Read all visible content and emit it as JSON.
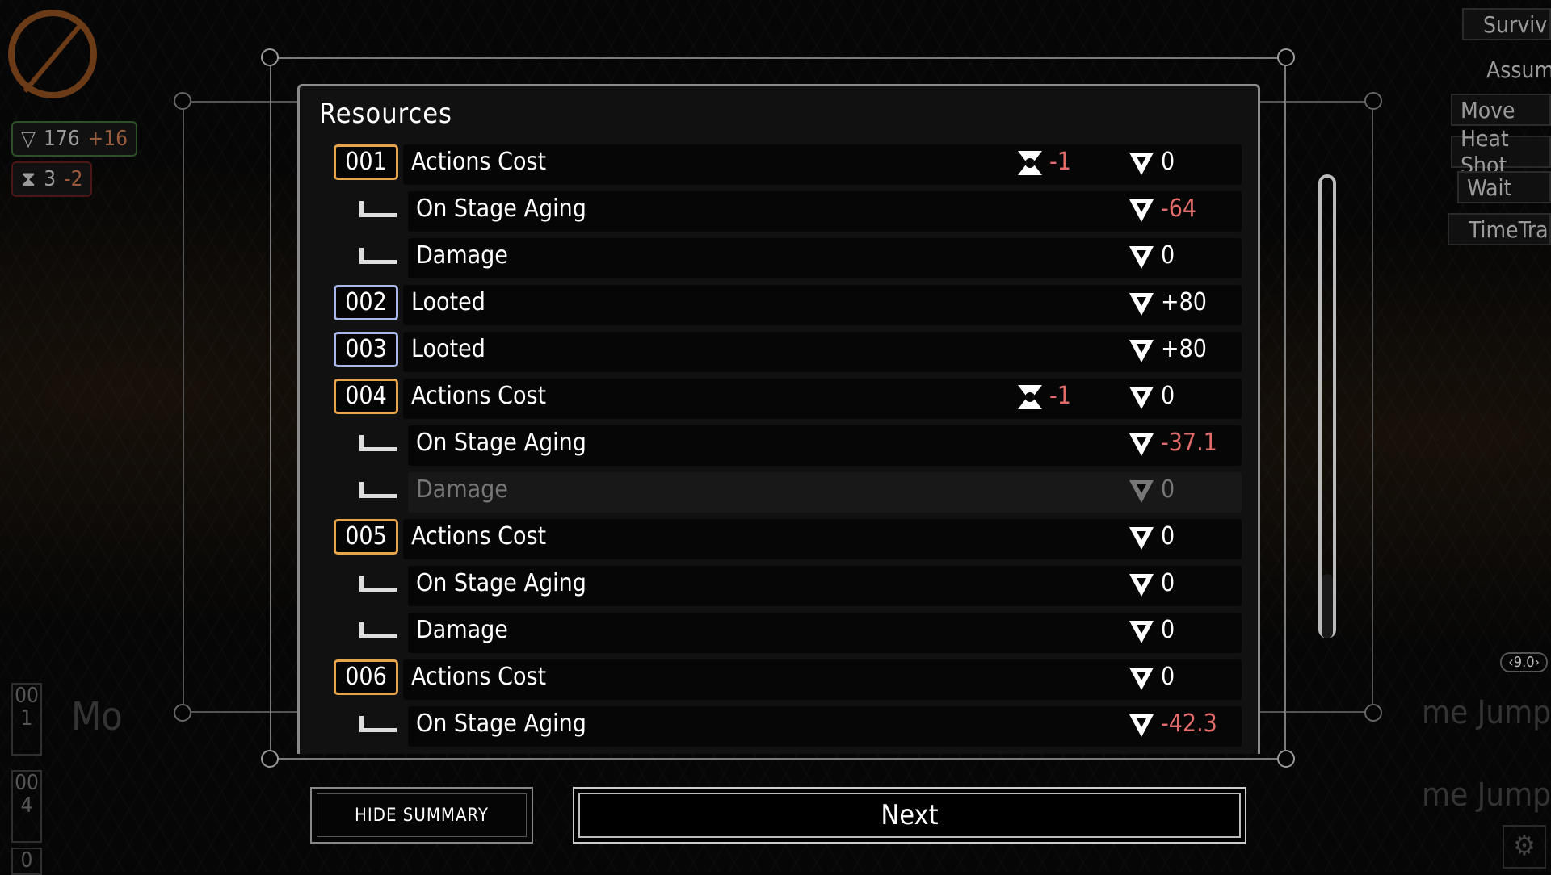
{
  "panel": {
    "title": "Resources"
  },
  "rows": [
    {
      "type": "main",
      "id": "001",
      "badge_color": "orange",
      "label": "Actions Cost",
      "action": "-1",
      "value": "0",
      "neg": false
    },
    {
      "type": "sub",
      "label": "On Stage Aging",
      "value": "-64",
      "neg": true
    },
    {
      "type": "sub",
      "label": "Damage",
      "value": "0",
      "neg": false
    },
    {
      "type": "main",
      "id": "002",
      "badge_color": "blue",
      "label": "Looted",
      "value": "+80",
      "neg": false
    },
    {
      "type": "main",
      "id": "003",
      "badge_color": "blue",
      "label": "Looted",
      "value": "+80",
      "neg": false
    },
    {
      "type": "main",
      "id": "004",
      "badge_color": "orange",
      "label": "Actions Cost",
      "action": "-1",
      "value": "0",
      "neg": false
    },
    {
      "type": "sub",
      "label": "On Stage Aging",
      "value": "-37.1",
      "neg": true
    },
    {
      "type": "sub",
      "label": "Damage",
      "value": "0",
      "neg": false,
      "dim": true
    },
    {
      "type": "main",
      "id": "005",
      "badge_color": "orange",
      "label": "Actions Cost",
      "value": "0",
      "neg": false
    },
    {
      "type": "sub",
      "label": "On Stage Aging",
      "value": "0",
      "neg": false
    },
    {
      "type": "sub",
      "label": "Damage",
      "value": "0",
      "neg": false
    },
    {
      "type": "main",
      "id": "006",
      "badge_color": "orange",
      "label": "Actions Cost",
      "value": "0",
      "neg": false
    },
    {
      "type": "sub",
      "label": "On Stage Aging",
      "value": "-42.3",
      "neg": true
    }
  ],
  "buttons": {
    "hide_summary": "HIDE SUMMARY",
    "next": "Next"
  },
  "background": {
    "left_stats": [
      {
        "value": "176",
        "delta": "+16"
      },
      {
        "value": "3",
        "delta": "-2"
      }
    ],
    "left_ghost": "Mo",
    "left_codes": [
      "001",
      "004",
      "0"
    ],
    "right_buttons": [
      "Surviv",
      "Assum",
      "Move",
      "Heat Shot",
      "Wait",
      "TimeTra"
    ],
    "right_ghost": [
      "me Jump",
      "me Jump"
    ],
    "zoom": "9.0"
  },
  "colors": {
    "orange": "#e6a54a",
    "blue": "#a9b6e6",
    "negative": "#e36b6b"
  }
}
